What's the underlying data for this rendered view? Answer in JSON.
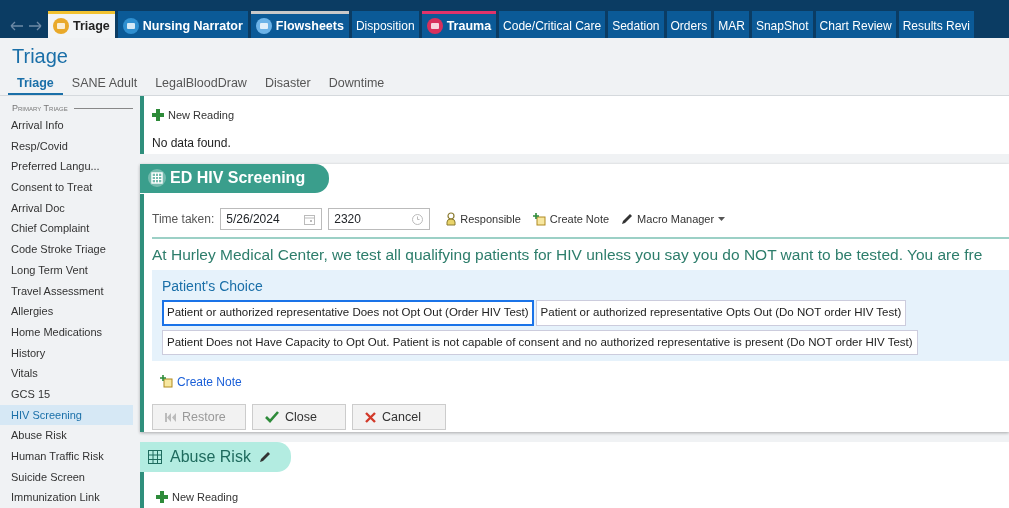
{
  "nav_tabs": [
    {
      "label": "Triage",
      "kind": "icon",
      "selected": true,
      "color": "#f2c230"
    },
    {
      "label": "Nursing Narrator",
      "kind": "icon",
      "selected": false
    },
    {
      "label": "Flowsheets",
      "kind": "icon",
      "selected": false,
      "color": "#c9c9c9"
    },
    {
      "label": "Disposition",
      "kind": "plain",
      "selected": false
    },
    {
      "label": "Trauma",
      "kind": "icon",
      "selected": false,
      "color": "#e0336a"
    },
    {
      "label": "Code/Critical Care",
      "kind": "plain",
      "selected": false
    },
    {
      "label": "Sedation",
      "kind": "plain",
      "selected": false
    },
    {
      "label": "Orders",
      "kind": "plain",
      "selected": false
    },
    {
      "label": "MAR",
      "kind": "plain",
      "selected": false
    },
    {
      "label": "SnapShot",
      "kind": "plain",
      "selected": false
    },
    {
      "label": "Chart Review",
      "kind": "plain",
      "selected": false
    },
    {
      "label": "Results Revi",
      "kind": "plain",
      "selected": false
    }
  ],
  "activity_title": "Triage",
  "sub_tabs": [
    {
      "label": "Triage",
      "selected": true
    },
    {
      "label": "SANE Adult",
      "selected": false
    },
    {
      "label": "LegalBloodDraw",
      "selected": false
    },
    {
      "label": "Disaster",
      "selected": false
    },
    {
      "label": "Downtime",
      "selected": false
    }
  ],
  "sidebar": {
    "heading": "Primary Triage",
    "items": [
      {
        "label": "Arrival Info",
        "selected": false
      },
      {
        "label": "Resp/Covid",
        "selected": false
      },
      {
        "label": "Preferred Langu...",
        "selected": false
      },
      {
        "label": "Consent to Treat",
        "selected": false
      },
      {
        "label": "Arrival Doc",
        "selected": false
      },
      {
        "label": "Chief Complaint",
        "selected": false
      },
      {
        "label": "Code Stroke Triage",
        "selected": false
      },
      {
        "label": "Long Term Vent",
        "selected": false
      },
      {
        "label": "Travel Assessment",
        "selected": false
      },
      {
        "label": "Allergies",
        "selected": false
      },
      {
        "label": "Home Medications",
        "selected": false
      },
      {
        "label": "History",
        "selected": false
      },
      {
        "label": "Vitals",
        "selected": false
      },
      {
        "label": "GCS 15",
        "selected": false
      },
      {
        "label": "HIV Screening",
        "selected": true
      },
      {
        "label": "Abuse Risk",
        "selected": false
      },
      {
        "label": "Human Traffic Risk",
        "selected": false
      },
      {
        "label": "Suicide Screen",
        "selected": false
      },
      {
        "label": "Immunization Link",
        "selected": false
      }
    ]
  },
  "readings_panel": {
    "new_reading": "New Reading",
    "message": "No data found."
  },
  "hiv_screening": {
    "title": "ED HIV Screening",
    "time_label": "Time taken:",
    "date": "5/26/2024",
    "time": "2320",
    "toolbar": [
      "Responsible",
      "Create Note",
      "Macro Manager"
    ],
    "statement": "At Hurley Medical Center, we test all qualifying patients for HIV unless you say you do NOT want to be tested. You are fre",
    "question": "Patient's Choice",
    "options": [
      {
        "label": "Patient or authorized representative Does not Opt Out (Order HIV Test)",
        "selected": true
      },
      {
        "label": "Patient or authorized representative Opts Out (Do NOT order HIV Test)",
        "selected": false
      },
      {
        "label": "Patient Does not Have Capacity to Opt Out. Patient is not capable of consent and no authorized representative is present (Do NOT order HIV Test)",
        "selected": false
      }
    ],
    "create_note": "Create Note",
    "buttons": [
      {
        "label": "Restore",
        "kind": "restore",
        "disabled": true
      },
      {
        "label": "Close",
        "kind": "close",
        "disabled": false
      },
      {
        "label": "Cancel",
        "kind": "cancel",
        "disabled": false
      }
    ]
  },
  "abuse_risk": {
    "title": "Abuse Risk",
    "new_reading": "New Reading"
  }
}
